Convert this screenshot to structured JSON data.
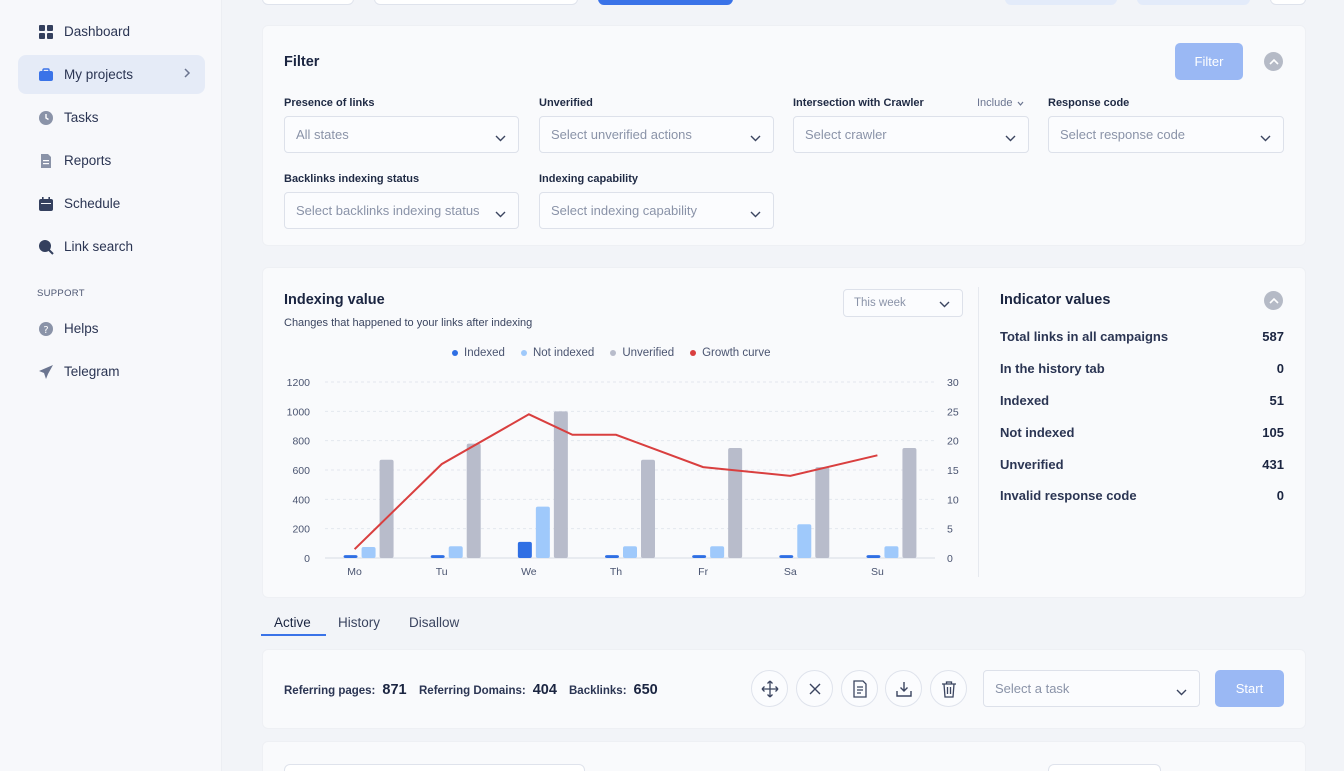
{
  "sidebar": {
    "items": [
      {
        "label": "Dashboard",
        "icon": "grid-icon"
      },
      {
        "label": "My projects",
        "icon": "briefcase-icon"
      },
      {
        "label": "Tasks",
        "icon": "clock-icon"
      },
      {
        "label": "Reports",
        "icon": "document-icon"
      },
      {
        "label": "Schedule",
        "icon": "calendar-icon"
      },
      {
        "label": "Link search",
        "icon": "search-icon"
      }
    ],
    "support_label": "SUPPORT",
    "support_items": [
      {
        "label": "Helps",
        "icon": "help-icon"
      },
      {
        "label": "Telegram",
        "icon": "telegram-icon"
      }
    ]
  },
  "filter": {
    "title": "Filter",
    "button": "Filter",
    "fields": [
      {
        "label": "Presence of links",
        "value": "All states"
      },
      {
        "label": "Unverified",
        "value": "Select unverified actions"
      },
      {
        "label": "Intersection with Crawler",
        "value": "Select crawler",
        "mode": "Include"
      },
      {
        "label": "Response code",
        "value": "Select response code"
      },
      {
        "label": "Backlinks indexing status",
        "value": "Select backlinks indexing status"
      },
      {
        "label": "Indexing capability",
        "value": "Select indexing capability"
      }
    ]
  },
  "indexing": {
    "title": "Indexing value",
    "subtitle": "Changes that happened to your links after indexing",
    "period": "This week"
  },
  "chart_data": {
    "type": "bar",
    "categories": [
      "Mo",
      "Tu",
      "We",
      "Th",
      "Fr",
      "Sa",
      "Su"
    ],
    "series": [
      {
        "name": "Indexed",
        "axis": "left",
        "values": [
          20,
          20,
          110,
          20,
          20,
          20,
          20
        ]
      },
      {
        "name": "Not indexed",
        "axis": "left",
        "values": [
          75,
          80,
          350,
          80,
          80,
          230,
          80
        ]
      },
      {
        "name": "Unverified",
        "axis": "left",
        "values": [
          670,
          780,
          1000,
          670,
          750,
          620,
          750
        ]
      },
      {
        "name": "Growth curve",
        "type": "line",
        "axis": "right",
        "values": [
          1.5,
          16,
          24.5,
          21,
          15.5,
          14,
          17.5
        ]
      }
    ],
    "extra_points": [
      {
        "category": "Th",
        "offset": -0.5,
        "value": 21
      }
    ],
    "ylim": [
      0,
      1200
    ],
    "y2lim": [
      0,
      30
    ],
    "yticks": [
      0,
      200,
      400,
      600,
      800,
      1000,
      1200
    ],
    "y2ticks": [
      0,
      5,
      10,
      15,
      20,
      25,
      30
    ],
    "legend": "top",
    "grid": true,
    "colors": {
      "Indexed": "#2f6fe4",
      "Not indexed": "#9fc9fb",
      "Unverified": "#b8bccb",
      "Growth curve": "#d93f3f"
    }
  },
  "indicators": {
    "title": "Indicator values",
    "rows": [
      {
        "label": "Total links in all campaigns",
        "value": "587"
      },
      {
        "label": "In the history tab",
        "value": "0"
      },
      {
        "label": "Indexed",
        "value": "51"
      },
      {
        "label": "Not indexed",
        "value": "105"
      },
      {
        "label": "Unverified",
        "value": "431"
      },
      {
        "label": "Invalid response code",
        "value": "0"
      }
    ]
  },
  "tabs": [
    "Active",
    "History",
    "Disallow"
  ],
  "stats": [
    {
      "label": "Referring pages:",
      "value": "871"
    },
    {
      "label": "Referring Domains:",
      "value": "404"
    },
    {
      "label": "Backlinks:",
      "value": "650"
    }
  ],
  "actions": {
    "task_placeholder": "Select a task",
    "start": "Start",
    "icons": [
      "move-icon",
      "close-icon",
      "report-icon",
      "download-icon",
      "trash-icon"
    ]
  }
}
